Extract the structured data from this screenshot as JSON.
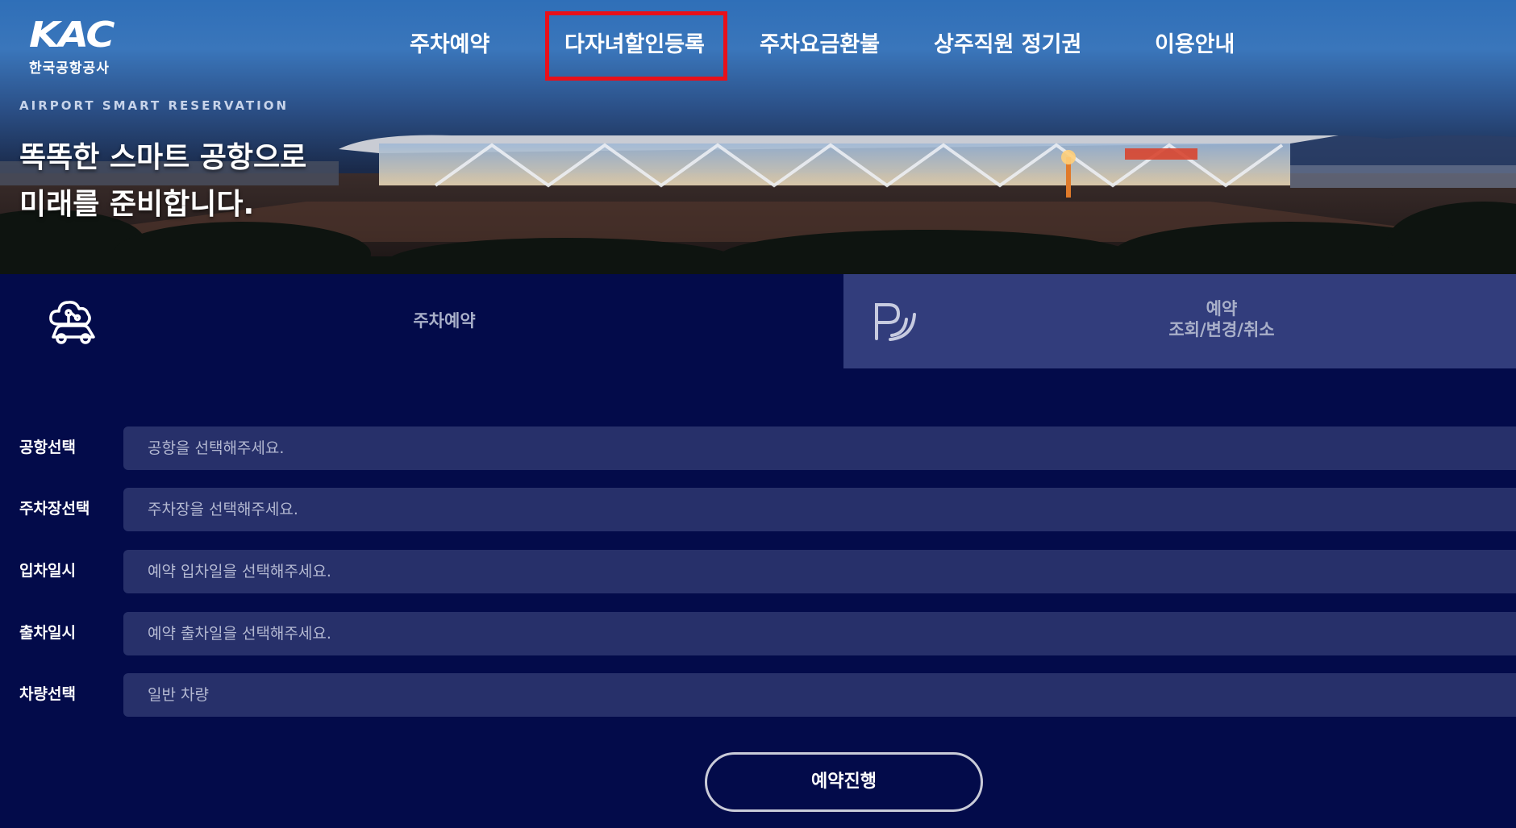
{
  "logo": {
    "mark": "KAC",
    "subtitle": "한국공항공사"
  },
  "nav": {
    "items": [
      {
        "label": "주차예약"
      },
      {
        "label": "다자녀할인등록"
      },
      {
        "label": "주차요금환불"
      },
      {
        "label": "상주직원 정기권"
      },
      {
        "label": "이용안내"
      }
    ]
  },
  "hero": {
    "kicker": "AIRPORT SMART RESERVATION",
    "line1": "똑똑한 스마트 공항으로",
    "line2": "미래를 준비합니다."
  },
  "tabs": {
    "reserve": {
      "label": "주차예약",
      "icon": "cloud-car-icon"
    },
    "lookup": {
      "label_line1": "예약",
      "label_line2": "조회/변경/취소",
      "icon": "parking-signal-icon"
    }
  },
  "form": {
    "rows": [
      {
        "label": "공항선택",
        "placeholder": "공항을 선택해주세요."
      },
      {
        "label": "주차장선택",
        "placeholder": "주차장을 선택해주세요."
      },
      {
        "label": "입차일시",
        "placeholder": "예약 입차일을 선택해주세요."
      },
      {
        "label": "출차일시",
        "placeholder": "예약 출차일을 선택해주세요."
      },
      {
        "label": "차량선택",
        "value": "일반 차량"
      }
    ],
    "submit_label": "예약진행"
  },
  "colors": {
    "page_bg": "#030b4a",
    "tab_inactive_bg": "#323d7c",
    "field_bg": "#27306a",
    "highlight": "#e8101a"
  }
}
